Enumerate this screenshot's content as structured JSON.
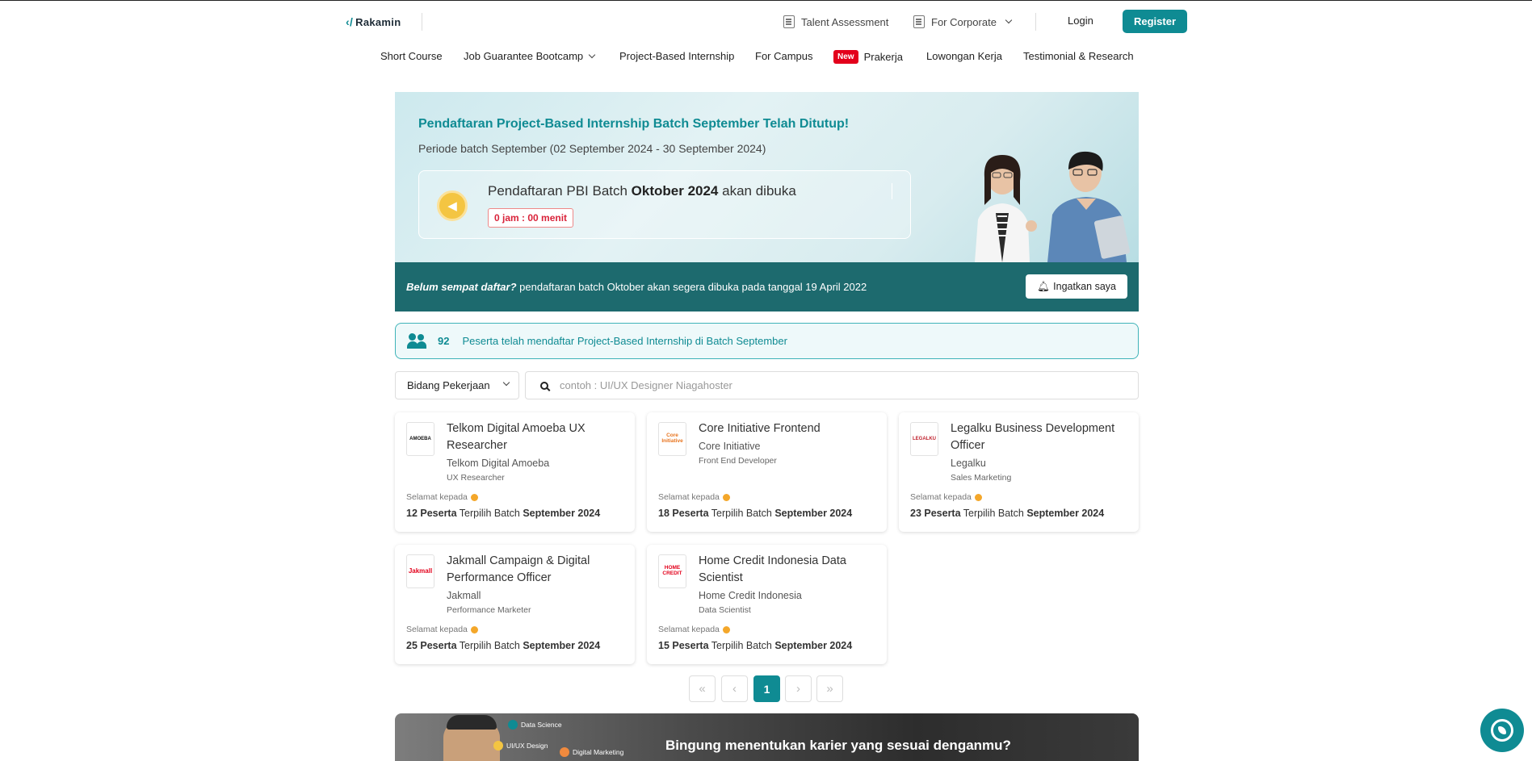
{
  "brand": {
    "name": "Rakamin"
  },
  "topbar": {
    "talent_assessment": "Talent Assessment",
    "for_corporate": "For Corporate",
    "login": "Login",
    "register": "Register"
  },
  "nav": {
    "items": [
      {
        "label": "Short Course"
      },
      {
        "label": "Job Guarantee Bootcamp"
      },
      {
        "label": "Project-Based Internship"
      },
      {
        "label": "For Campus"
      },
      {
        "badge": "New",
        "label": "Prakerja"
      },
      {
        "label": "Lowongan Kerja"
      },
      {
        "label": "Testimonial & Research"
      }
    ]
  },
  "hero": {
    "title": "Pendaftaran Project-Based Internship Batch September Telah Ditutup!",
    "period": "Periode batch September (02 September 2024 - 30 September 2024)",
    "open_prefix": "Pendaftaran PBI Batch ",
    "open_batch": "Oktober 2024",
    "open_suffix": " akan dibuka",
    "countdown": "0 jam : 00 menit"
  },
  "reminder": {
    "lead": "Belum sempat daftar?",
    "text": " pendaftaran batch Oktober akan segera dibuka pada tanggal 19 April 2022",
    "button": "Ingatkan saya"
  },
  "participants": {
    "count": "92",
    "text": "Peserta telah mendaftar Project-Based Internship di Batch September"
  },
  "filters": {
    "field_select": "Bidang Pekerjaan",
    "search_placeholder": "contoh : UI/UX Designer Niagahoster"
  },
  "cards": [
    {
      "logo": "AMOEBA",
      "title": "Telkom Digital Amoeba UX Researcher",
      "company": "Telkom Digital Amoeba",
      "role": "UX Researcher",
      "congrats": "Selamat kepada",
      "count": "12 Peserta",
      "mid": " Terpilih Batch ",
      "batch": "September 2024"
    },
    {
      "logo": "Core Initiative",
      "title": "Core Initiative Frontend",
      "company": "Core Initiative",
      "role": "Front End Developer",
      "congrats": "Selamat kepada",
      "count": "18 Peserta",
      "mid": " Terpilih Batch ",
      "batch": "September 2024"
    },
    {
      "logo": "LEGALKU",
      "title": "Legalku Business Development Officer",
      "company": "Legalku",
      "role": "Sales Marketing",
      "congrats": "Selamat kepada",
      "count": "23 Peserta",
      "mid": " Terpilih Batch ",
      "batch": "September 2024"
    },
    {
      "logo": "Jakmall",
      "title": "Jakmall Campaign & Digital Performance Officer",
      "company": "Jakmall",
      "role": "Performance Marketer",
      "congrats": "Selamat kepada",
      "count": "25 Peserta",
      "mid": " Terpilih Batch ",
      "batch": "September 2024"
    },
    {
      "logo": "HOME CREDIT",
      "title": "Home Credit Indonesia Data Scientist",
      "company": "Home Credit Indonesia",
      "role": "Data Scientist",
      "congrats": "Selamat kepada",
      "count": "15 Peserta",
      "mid": " Terpilih Batch ",
      "batch": "September 2024"
    }
  ],
  "pagination": {
    "first": "«",
    "prev": "‹",
    "current": "1",
    "next": "›",
    "last": "»"
  },
  "banner": {
    "chips": [
      "Data Science",
      "UI/UX Design",
      "Digital Marketing"
    ],
    "headline": "Bingung menentukan karier yang sesuai denganmu?"
  },
  "colors": {
    "accent": "#0f8b93",
    "dark_teal": "#1d6a6e",
    "countdown_red": "#d9233a",
    "new_badge": "#e3001b"
  }
}
